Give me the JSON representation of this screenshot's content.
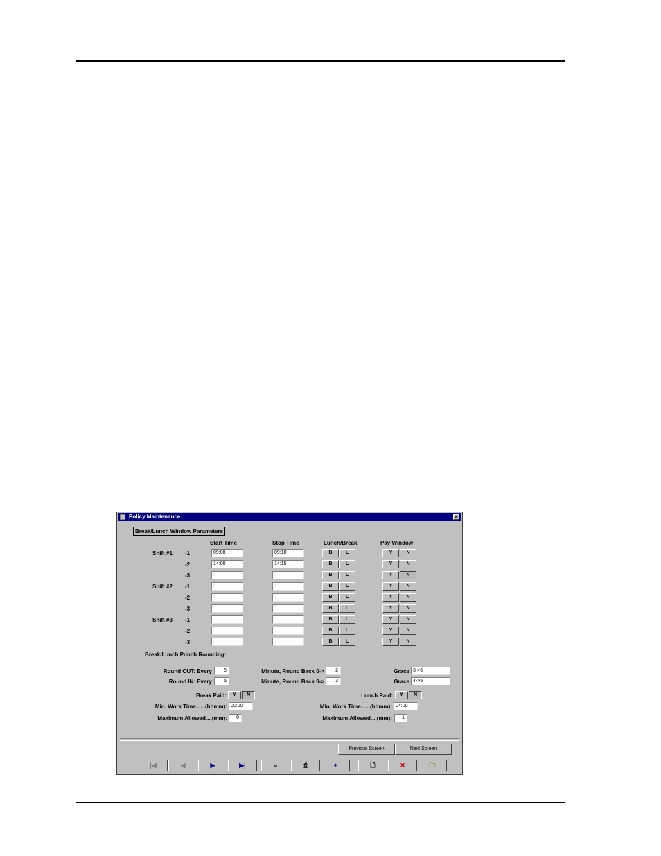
{
  "window": {
    "title": "Policy Maintenance",
    "close_glyph": "✕"
  },
  "group_title": "Break/Lunch Window Parameters",
  "columns": {
    "start": "Start Time",
    "stop": "Stop Time",
    "lunch_break": "Lunch/Break",
    "pay_window": "Pay Window"
  },
  "shift_labels": [
    "Shift #1",
    "Shift #2",
    "Shift #3"
  ],
  "rows": [
    {
      "sub": "-1",
      "start": "09:00",
      "stop": "09:10"
    },
    {
      "sub": "-2",
      "start": "14:00",
      "stop": "14:15"
    },
    {
      "sub": "-3",
      "start": ":",
      "stop": ":"
    },
    {
      "sub": "-1",
      "start": ":",
      "stop": ":"
    },
    {
      "sub": "-2",
      "start": ":",
      "stop": ":"
    },
    {
      "sub": "-3",
      "start": ":",
      "stop": ":"
    },
    {
      "sub": "-1",
      "start": ":",
      "stop": ":"
    },
    {
      "sub": "-2",
      "start": ":",
      "stop": ":"
    },
    {
      "sub": "-3",
      "start": ":",
      "stop": ":"
    }
  ],
  "buttons": {
    "b": "B",
    "l": "L",
    "y": "Y",
    "n": "N"
  },
  "rounding": {
    "heading": "Break/Lunch Punch Rounding:",
    "out_label": "Round OUT: Every",
    "out_value": "5",
    "in_label": "Round IN: Every",
    "in_value": "5",
    "back_label": "Minute, Round Back 0->",
    "out_back": "2",
    "in_back": "3",
    "grace_label": "Grace",
    "out_grace": "3->5",
    "in_grace": "4->5"
  },
  "break_paid": {
    "label": "Break Paid:",
    "min_work_label": "Min. Work Time......(hhmm):",
    "min_work": "00:00",
    "max_label": "Maximum Allowed....(mm):",
    "max": "0"
  },
  "lunch_paid": {
    "label": "Lunch Paid:",
    "min_work_label": "Min. Work Time......(hhmm):",
    "min_work": "04:00",
    "max_label": "Maximum Allowed....(mm):",
    "max": "1"
  },
  "screen_nav": {
    "previous": "Previous Screen",
    "next": "Next Screen"
  },
  "toolbar_icons": [
    "first-record-icon",
    "previous-record-icon",
    "next-record-icon",
    "last-record-icon",
    "find-icon",
    "print-icon",
    "search-icon",
    "new-record-icon",
    "delete-record-icon",
    "open-folder-icon"
  ],
  "toolbar_glyphs": {
    "first": "|◀",
    "prev": "◀",
    "next": "▶",
    "last": "▶|",
    "find": "⌕",
    "print": "⎙",
    "search": "⌖",
    "new": "🗋",
    "delete": "✕",
    "open": "🗀"
  }
}
